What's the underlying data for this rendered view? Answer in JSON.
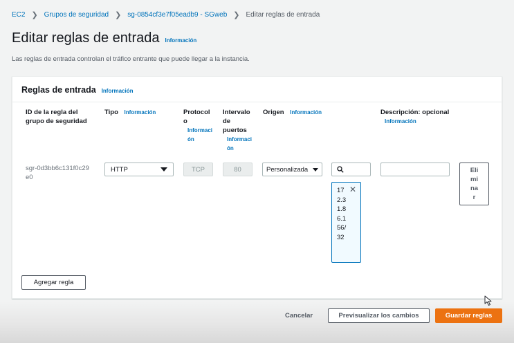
{
  "breadcrumb": {
    "items": [
      "EC2",
      "Grupos de seguridad",
      "sg-0854cf3e7f05eadb9 - SGweb",
      "Editar reglas de entrada"
    ],
    "separator": ">"
  },
  "page": {
    "title": "Editar reglas de entrada",
    "info": "Información",
    "description": "Las reglas de entrada controlan el tráfico entrante que puede llegar a la instancia."
  },
  "rules_panel": {
    "title": "Reglas de entrada",
    "info": "Información",
    "columns": {
      "rule_id": "ID de la regla del grupo de seguridad",
      "type": "Tipo",
      "type_info": "Información",
      "protocol": "Protocolo",
      "protocol_info": "Información",
      "port_range": "Intervalo de puertos",
      "port_range_info": "Información",
      "source": "Origen",
      "source_info": "Información",
      "description": "Descripción: opcional",
      "description_info": "Información"
    },
    "rule": {
      "id": "sgr-0d3bb6c131f0c29e0",
      "type": "HTTP",
      "protocol": "TCP",
      "port_range": "80",
      "source": "Personalizada",
      "search_value": "",
      "token": "172.31.86.156/32",
      "description_value": "",
      "delete_label": "Eliminar"
    },
    "add_rule_label": "Agregar regla"
  },
  "footer": {
    "cancel_label": "Cancelar",
    "preview_label": "Previsualizar los cambios",
    "save_label": "Guardar reglas"
  },
  "colors": {
    "link": "#0073bb",
    "primary": "#ec7211",
    "background": "#f2f3f3"
  },
  "icons": [
    "chevron-right-icon",
    "caret-down-icon",
    "search-icon",
    "close-icon",
    "mouse-cursor-icon"
  ]
}
